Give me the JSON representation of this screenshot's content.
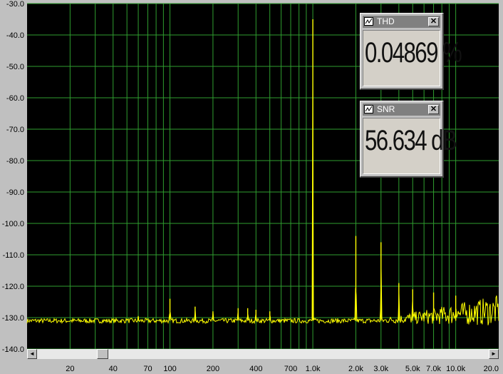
{
  "analyzer": {
    "y_axis": {
      "min": -140,
      "max": -30,
      "step": 10,
      "labels": [
        "-30.0",
        "-40.0",
        "-50.0",
        "-60.0",
        "-70.0",
        "-80.0",
        "-90.0",
        "-100.0",
        "-110.0",
        "-120.0",
        "-130.0",
        "-140.0"
      ]
    },
    "x_axis": {
      "scale": "log",
      "min": 10,
      "max": 20000,
      "labels": [
        {
          "text": "20",
          "value": 20
        },
        {
          "text": "40",
          "value": 40
        },
        {
          "text": "70",
          "value": 70
        },
        {
          "text": "100",
          "value": 100
        },
        {
          "text": "200",
          "value": 200
        },
        {
          "text": "400",
          "value": 400
        },
        {
          "text": "700",
          "value": 700
        },
        {
          "text": "1.0k",
          "value": 1000
        },
        {
          "text": "2.0k",
          "value": 2000
        },
        {
          "text": "3.0k",
          "value": 3000
        },
        {
          "text": "5.0k",
          "value": 5000
        },
        {
          "text": "7.0k",
          "value": 7000
        },
        {
          "text": "10.0k",
          "value": 10000
        },
        {
          "text": "20.0",
          "value": 20000
        }
      ]
    },
    "colors": {
      "background": "#000000",
      "grid": "#2f9e2f",
      "trace": "#ffff00",
      "frame": "#c0c0c0"
    },
    "scrollbar": {
      "left_arrow": "◄",
      "right_arrow": "►"
    }
  },
  "meters": {
    "thd": {
      "title": "THD",
      "value": "0.04869 %",
      "close_label": "✕"
    },
    "snr": {
      "title": "SNR",
      "value": "56.634 dB",
      "close_label": "✕"
    }
  },
  "chart_data": {
    "type": "line",
    "xscale": "log",
    "xlim": [
      10,
      20000
    ],
    "ylim": [
      -140,
      -30
    ],
    "grid": true,
    "noise_floor_db": -131,
    "series": [
      {
        "peaks": [
          {
            "x": 50,
            "y": -130.5
          },
          {
            "x": 60,
            "y": -129.5
          },
          {
            "x": 100,
            "y": -124
          },
          {
            "x": 150,
            "y": -126.5
          },
          {
            "x": 200,
            "y": -128
          },
          {
            "x": 300,
            "y": -127
          },
          {
            "x": 350,
            "y": -127
          },
          {
            "x": 400,
            "y": -127.5
          },
          {
            "x": 500,
            "y": -128
          },
          {
            "x": 1000,
            "y": -35
          },
          {
            "x": 2000,
            "y": -104
          },
          {
            "x": 3000,
            "y": -106
          },
          {
            "x": 4000,
            "y": -119
          },
          {
            "x": 5000,
            "y": -121
          },
          {
            "x": 7000,
            "y": -122
          },
          {
            "x": 10000,
            "y": -123
          }
        ]
      }
    ]
  }
}
